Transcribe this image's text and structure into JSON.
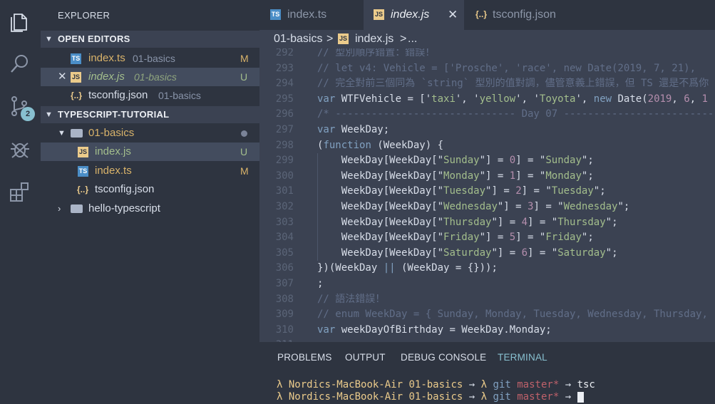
{
  "activity_bar": {
    "items": [
      "files-icon",
      "search-icon",
      "source-control-icon",
      "debug-icon",
      "extensions-icon"
    ],
    "scm_badge": "2"
  },
  "sidebar": {
    "title": "EXPLORER",
    "open_editors": {
      "label": "OPEN EDITORS",
      "items": [
        {
          "icon": "TS",
          "name": "index.ts",
          "dir": "01-basics",
          "status": "M"
        },
        {
          "icon": "JS",
          "name": "index.js",
          "dir": "01-basics",
          "status": "U"
        },
        {
          "icon": "{..}",
          "name": "tsconfig.json",
          "dir": "01-basics",
          "status": ""
        }
      ]
    },
    "project": {
      "label": "TYPESCRIPT-TUTORIAL",
      "folder": "01-basics",
      "files": [
        {
          "icon": "JS",
          "name": "index.js",
          "status": "U"
        },
        {
          "icon": "TS",
          "name": "index.ts",
          "status": "M"
        },
        {
          "icon": "{..}",
          "name": "tsconfig.json",
          "status": ""
        }
      ],
      "collapsed_folder": "hello-typescript"
    }
  },
  "tabs": [
    {
      "icon": "TS",
      "label": "index.ts"
    },
    {
      "icon": "JS",
      "label": "index.js",
      "close": "✕"
    },
    {
      "icon": "{..}",
      "label": "tsconfig.json"
    }
  ],
  "breadcrumb": {
    "folder": "01-basics",
    "sep": ">",
    "file": "index.js",
    "sep2": ">",
    "tail": "..."
  },
  "code_lines": [
    {
      "n": "292",
      "tokens": [
        {
          "t": "cm",
          "v": "// 型別順序錯置：錯誤！"
        }
      ]
    },
    {
      "n": "293",
      "tokens": [
        {
          "t": "cm",
          "v": "// let v4: Vehicle = ['Prosche', 'race', new Date(2019, 7, 21), "
        }
      ]
    },
    {
      "n": "294",
      "tokens": [
        {
          "t": "cm",
          "v": "// 完全對前三個同為 `string` 型別的值對調，儘管意義上錯誤，但 TS 還是不爲你"
        }
      ]
    },
    {
      "n": "295",
      "tokens": [
        {
          "t": "kw",
          "v": "var"
        },
        {
          "t": "p",
          "v": " WTFVehicle = ['"
        },
        {
          "t": "str",
          "v": "taxi"
        },
        {
          "t": "p",
          "v": "', '"
        },
        {
          "t": "str",
          "v": "yellow"
        },
        {
          "t": "p",
          "v": "', '"
        },
        {
          "t": "str",
          "v": "Toyota"
        },
        {
          "t": "p",
          "v": "', "
        },
        {
          "t": "kw",
          "v": "new"
        },
        {
          "t": "p",
          "v": " Date("
        },
        {
          "t": "num",
          "v": "2019"
        },
        {
          "t": "p",
          "v": ", "
        },
        {
          "t": "num",
          "v": "6"
        },
        {
          "t": "p",
          "v": ", "
        },
        {
          "t": "num",
          "v": "1"
        }
      ]
    },
    {
      "n": "296",
      "tokens": [
        {
          "t": "cm",
          "v": "/* ------------------------------ Day 07 ------------------------------"
        }
      ]
    },
    {
      "n": "297",
      "tokens": [
        {
          "t": "kw",
          "v": "var"
        },
        {
          "t": "p",
          "v": " WeekDay;"
        }
      ]
    },
    {
      "n": "298",
      "tokens": [
        {
          "t": "p",
          "v": "("
        },
        {
          "t": "kw",
          "v": "function"
        },
        {
          "t": "p",
          "v": " (WeekDay) {"
        }
      ]
    },
    {
      "n": "299",
      "tokens": [
        {
          "t": "p",
          "v": "    WeekDay[WeekDay[\""
        },
        {
          "t": "str",
          "v": "Sunday"
        },
        {
          "t": "p",
          "v": "\"] = "
        },
        {
          "t": "num",
          "v": "0"
        },
        {
          "t": "p",
          "v": "] = \""
        },
        {
          "t": "str",
          "v": "Sunday"
        },
        {
          "t": "p",
          "v": "\";"
        }
      ]
    },
    {
      "n": "300",
      "tokens": [
        {
          "t": "p",
          "v": "    WeekDay[WeekDay[\""
        },
        {
          "t": "str",
          "v": "Monday"
        },
        {
          "t": "p",
          "v": "\"] = "
        },
        {
          "t": "num",
          "v": "1"
        },
        {
          "t": "p",
          "v": "] = \""
        },
        {
          "t": "str",
          "v": "Monday"
        },
        {
          "t": "p",
          "v": "\";"
        }
      ]
    },
    {
      "n": "301",
      "tokens": [
        {
          "t": "p",
          "v": "    WeekDay[WeekDay[\""
        },
        {
          "t": "str",
          "v": "Tuesday"
        },
        {
          "t": "p",
          "v": "\"] = "
        },
        {
          "t": "num",
          "v": "2"
        },
        {
          "t": "p",
          "v": "] = \""
        },
        {
          "t": "str",
          "v": "Tuesday"
        },
        {
          "t": "p",
          "v": "\";"
        }
      ]
    },
    {
      "n": "302",
      "tokens": [
        {
          "t": "p",
          "v": "    WeekDay[WeekDay[\""
        },
        {
          "t": "str",
          "v": "Wednesday"
        },
        {
          "t": "p",
          "v": "\"] = "
        },
        {
          "t": "num",
          "v": "3"
        },
        {
          "t": "p",
          "v": "] = \""
        },
        {
          "t": "str",
          "v": "Wednesday"
        },
        {
          "t": "p",
          "v": "\";"
        }
      ]
    },
    {
      "n": "303",
      "tokens": [
        {
          "t": "p",
          "v": "    WeekDay[WeekDay[\""
        },
        {
          "t": "str",
          "v": "Thursday"
        },
        {
          "t": "p",
          "v": "\"] = "
        },
        {
          "t": "num",
          "v": "4"
        },
        {
          "t": "p",
          "v": "] = \""
        },
        {
          "t": "str",
          "v": "Thursday"
        },
        {
          "t": "p",
          "v": "\";"
        }
      ]
    },
    {
      "n": "304",
      "tokens": [
        {
          "t": "p",
          "v": "    WeekDay[WeekDay[\""
        },
        {
          "t": "str",
          "v": "Friday"
        },
        {
          "t": "p",
          "v": "\"] = "
        },
        {
          "t": "num",
          "v": "5"
        },
        {
          "t": "p",
          "v": "] = \""
        },
        {
          "t": "str",
          "v": "Friday"
        },
        {
          "t": "p",
          "v": "\";"
        }
      ]
    },
    {
      "n": "305",
      "tokens": [
        {
          "t": "p",
          "v": "    WeekDay[WeekDay[\""
        },
        {
          "t": "str",
          "v": "Saturday"
        },
        {
          "t": "p",
          "v": "\"] = "
        },
        {
          "t": "num",
          "v": "6"
        },
        {
          "t": "p",
          "v": "] = \""
        },
        {
          "t": "str",
          "v": "Saturday"
        },
        {
          "t": "p",
          "v": "\";"
        }
      ]
    },
    {
      "n": "306",
      "tokens": [
        {
          "t": "p",
          "v": "})(WeekDay "
        },
        {
          "t": "kw",
          "v": "||"
        },
        {
          "t": "p",
          "v": " (WeekDay = {}));"
        }
      ]
    },
    {
      "n": "307",
      "tokens": [
        {
          "t": "p",
          "v": ";"
        }
      ]
    },
    {
      "n": "308",
      "tokens": [
        {
          "t": "cm",
          "v": "// 語法錯誤！"
        }
      ]
    },
    {
      "n": "309",
      "tokens": [
        {
          "t": "cm",
          "v": "// enum WeekDay = { Sunday, Monday, Tuesday, Wednesday, Thursday,"
        }
      ]
    },
    {
      "n": "310",
      "tokens": [
        {
          "t": "kw",
          "v": "var"
        },
        {
          "t": "p",
          "v": " weekDayOfBirthday = WeekDay.Monday;"
        }
      ]
    },
    {
      "n": "311",
      "tokens": []
    }
  ],
  "panel": {
    "tabs": [
      "PROBLEMS",
      "OUTPUT",
      "DEBUG CONSOLE",
      "TERMINAL"
    ],
    "terminal": [
      {
        "lambda": "λ",
        "host": "Nordics-MacBook-Air",
        "dir": "01-basics",
        "arrow1": "→",
        "lambda2": "λ",
        "git": "git",
        "branch": "master*",
        "arrow2": "→",
        "cmd": "tsc"
      },
      {
        "lambda": "λ",
        "host": "Nordics-MacBook-Air",
        "dir": "01-basics",
        "arrow1": "→",
        "lambda2": "λ",
        "git": "git",
        "branch": "master*",
        "arrow2": "→",
        "cmd": ""
      }
    ]
  },
  "colors": {
    "bg": "#2E3440",
    "editor_bg": "#3B4252",
    "accent": "#88C0D0",
    "modified": "#D9B36A",
    "untracked": "#A3BE8C"
  }
}
